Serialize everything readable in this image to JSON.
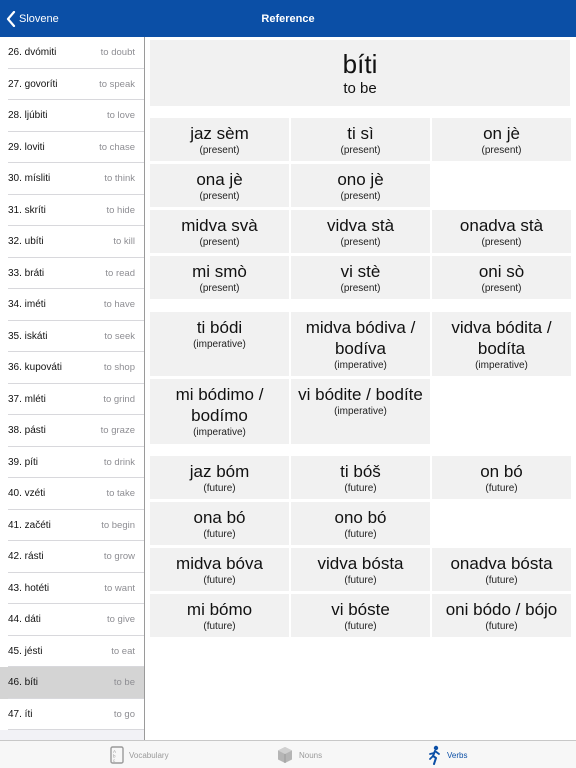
{
  "nav": {
    "back_label": "Slovene",
    "title": "Reference"
  },
  "list": [
    {
      "word": "26. dvómiti",
      "meaning": "to doubt"
    },
    {
      "word": "27. govoríti",
      "meaning": "to speak"
    },
    {
      "word": "28. ljúbiti",
      "meaning": "to love"
    },
    {
      "word": "29. loviti",
      "meaning": "to chase"
    },
    {
      "word": "30. mísliti",
      "meaning": "to think"
    },
    {
      "word": "31. skríti",
      "meaning": "to hide"
    },
    {
      "word": "32. ubíti",
      "meaning": "to kill"
    },
    {
      "word": "33. bráti",
      "meaning": "to read"
    },
    {
      "word": "34. iméti",
      "meaning": "to have"
    },
    {
      "word": "35. iskáti",
      "meaning": "to seek"
    },
    {
      "word": "36. kupováti",
      "meaning": "to shop"
    },
    {
      "word": "37. mléti",
      "meaning": "to grind"
    },
    {
      "word": "38. pásti",
      "meaning": "to graze"
    },
    {
      "word": "39. píti",
      "meaning": "to drink"
    },
    {
      "word": "40. vzéti",
      "meaning": "to take"
    },
    {
      "word": "41. začéti",
      "meaning": "to begin"
    },
    {
      "word": "42. rásti",
      "meaning": "to grow"
    },
    {
      "word": "43. hotéti",
      "meaning": "to want"
    },
    {
      "word": "44. dáti",
      "meaning": "to give"
    },
    {
      "word": "45. jésti",
      "meaning": "to eat"
    },
    {
      "word": "46. bíti",
      "meaning": "to be",
      "selected": true
    },
    {
      "word": "47. íti",
      "meaning": "to go"
    }
  ],
  "verb": {
    "title": "bíti",
    "meaning": "to be"
  },
  "present": [
    {
      "form": "jaz sèm",
      "tag": "(present)"
    },
    {
      "form": "ti sì",
      "tag": "(present)"
    },
    {
      "form": "on jè",
      "tag": "(present)"
    },
    {
      "form": "ona jè",
      "tag": "(present)"
    },
    {
      "form": "ono jè",
      "tag": "(present)"
    },
    {
      "form": "midva svà",
      "tag": "(present)"
    },
    {
      "form": "vidva stà",
      "tag": "(present)"
    },
    {
      "form": "onadva stà",
      "tag": "(present)"
    },
    {
      "form": "mi smò",
      "tag": "(present)"
    },
    {
      "form": "vi stè",
      "tag": "(present)"
    },
    {
      "form": "oni sò",
      "tag": "(present)"
    }
  ],
  "imperative": [
    {
      "form": "ti bódi",
      "tag": "(imperative)"
    },
    {
      "form": "midva bódiva / bodíva",
      "tag": "(imperative)"
    },
    {
      "form": "vidva bódita / bodíta",
      "tag": "(imperative)"
    },
    {
      "form": "mi bódimo / bodímo",
      "tag": "(imperative)"
    },
    {
      "form": "vi bódite / bodíte",
      "tag": "(imperative)"
    }
  ],
  "future": [
    {
      "form": "jaz bóm",
      "tag": "(future)"
    },
    {
      "form": "ti bóš",
      "tag": "(future)"
    },
    {
      "form": "on bó",
      "tag": "(future)"
    },
    {
      "form": "ona bó",
      "tag": "(future)"
    },
    {
      "form": "ono bó",
      "tag": "(future)"
    },
    {
      "form": "midva bóva",
      "tag": "(future)"
    },
    {
      "form": "vidva bósta",
      "tag": "(future)"
    },
    {
      "form": "onadva bósta",
      "tag": "(future)"
    },
    {
      "form": "mi bómo",
      "tag": "(future)"
    },
    {
      "form": "vi bóste",
      "tag": "(future)"
    },
    {
      "form": "oni bódo / bójo",
      "tag": "(future)"
    }
  ],
  "tabs": [
    {
      "label": "Vocabulary",
      "icon": "vocabulary-icon",
      "active": false
    },
    {
      "label": "Nouns",
      "icon": "nouns-icon",
      "active": false
    },
    {
      "label": "Verbs",
      "icon": "verbs-icon",
      "active": true
    }
  ],
  "colors": {
    "accent": "#0b4fa6",
    "cell_background": "#f1f1f1",
    "selected_row": "#d4d4d4"
  }
}
